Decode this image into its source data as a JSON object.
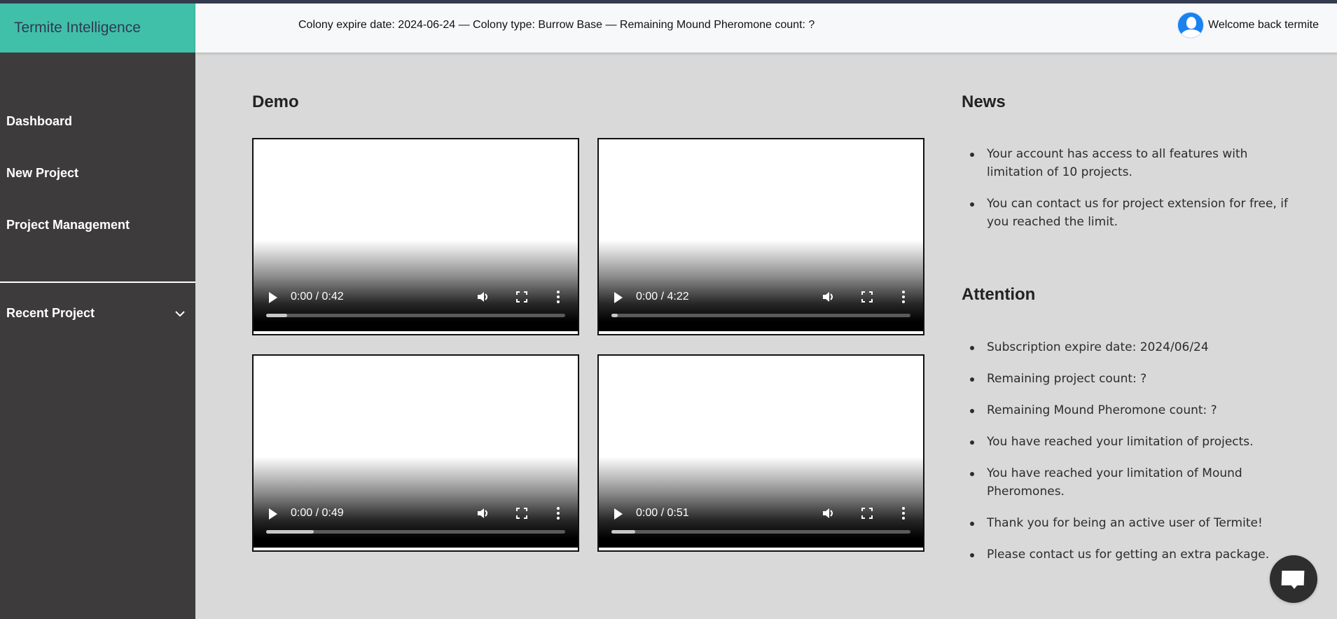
{
  "brand": {
    "title": "Termite Intelligence",
    "color": "#40c0a8"
  },
  "header": {
    "info": "Colony expire date: 2024-06-24 — Colony type: Burrow Base — Remaining Mound Pheromone count: ?",
    "welcome": "Welcome back termite",
    "avatar_icon": "user-avatar-icon"
  },
  "sidebar": {
    "items": [
      {
        "label": "Dashboard"
      },
      {
        "label": "New Project"
      },
      {
        "label": "Project Management"
      }
    ],
    "recent": {
      "label": "Recent Project",
      "icon": "chevron-down-icon"
    }
  },
  "demo": {
    "title": "Demo",
    "videos": [
      {
        "time": "0:00 / 0:42",
        "progress_pct": 7
      },
      {
        "time": "0:00 / 4:22",
        "progress_pct": 2
      },
      {
        "time": "0:00 / 0:49",
        "progress_pct": 16
      },
      {
        "time": "0:00 / 0:51",
        "progress_pct": 8
      }
    ]
  },
  "news": {
    "title": "News",
    "items": [
      "Your account has access to all features with limitation of 10 projects.",
      "You can contact us for project extension for free, if you reached the limit."
    ]
  },
  "attention": {
    "title": "Attention",
    "items": [
      "Subscription expire date: 2024/06/24",
      "Remaining project count: ?",
      "Remaining Mound Pheromone count: ?",
      "You have reached your limitation of projects.",
      "You have reached your limitation of Mound Pheromones.",
      "Thank you for being an active user of Termite!",
      "Please contact us for getting an extra package."
    ]
  },
  "chat": {
    "icon": "chat-bubble-icon"
  }
}
